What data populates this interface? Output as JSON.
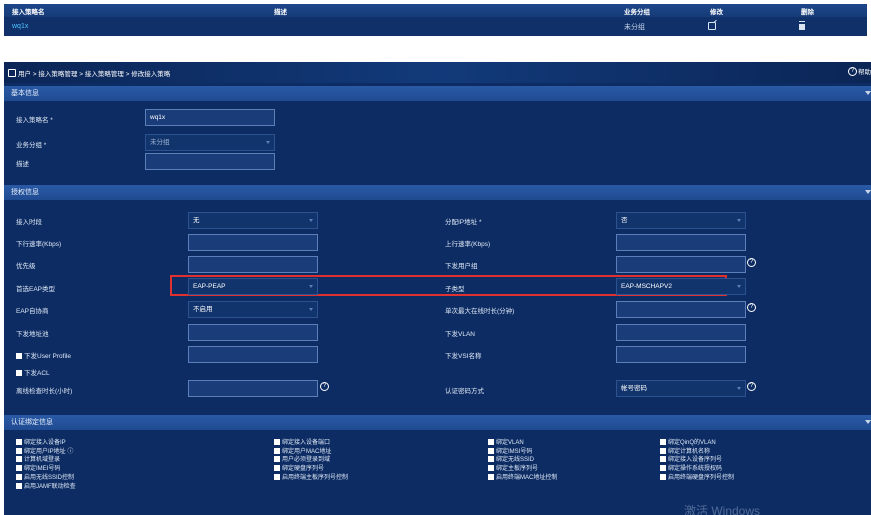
{
  "top_table": {
    "headers": {
      "name": "接入策略名",
      "desc": "描述",
      "group": "业务分组",
      "edit": "修改",
      "delete": "删除"
    },
    "row": {
      "name": "wq1x",
      "desc": "",
      "group": "未分组"
    }
  },
  "breadcrumb": "用户 > 接入策略管理 > 接入策略管理 > 修改接入策略",
  "help_label": "帮助",
  "basic": {
    "title": "基本信息",
    "name_label": "接入策略名 *",
    "name_value": "wq1x",
    "group_label": "业务分组 *",
    "group_value": "未分组",
    "desc_label": "描述",
    "desc_value": ""
  },
  "auth": {
    "title": "授权信息",
    "access_period_label": "接入时段",
    "access_period_value": "无",
    "assign_ip_label": "分配IP地址 *",
    "assign_ip_value": "否",
    "down_rate_label": "下行速率(Kbps)",
    "up_rate_label": "上行速率(Kbps)",
    "priority_label": "优先级",
    "user_group_label": "下发用户组",
    "eap_type_label": "首选EAP类型",
    "eap_type_value": "EAP-PEAP",
    "subtype_label": "子类型",
    "subtype_value": "EAP-MSCHAPV2",
    "eap_negotiate_label": "EAP自协商",
    "eap_negotiate_value": "不启用",
    "max_online_label": "单次最大在线时长(分钟)",
    "addr_pool_label": "下发地址池",
    "vlan_label": "下发VLAN",
    "user_profile_label": "下发User Profile",
    "vsi_label": "下发VSI名称",
    "acl_label": "下发ACL",
    "offline_check_label": "离线检查时长(小时)",
    "auth_pwd_label": "认证密码方式",
    "auth_pwd_value": "帐号密码"
  },
  "binding": {
    "title": "认证绑定信息",
    "col1": [
      "绑定接入设备IP",
      "绑定用户IP地址",
      "计算机域登录",
      "绑定IMEI号码",
      "启用无线SSID控制",
      "启用JAMF联动检查"
    ],
    "col2": [
      "绑定接入设备端口",
      "绑定用户MAC地址",
      "用户必须登录到域",
      "绑定硬盘序列号",
      "启用终端主板序列号控制"
    ],
    "col3": [
      "绑定VLAN",
      "绑定IMSI号码",
      "绑定无线SSID",
      "绑定主板序列号",
      "启用终端MAC地址控制"
    ],
    "col4": [
      "绑定QinQ的VLAN",
      "绑定计算机名称",
      "绑定接入设备序列号",
      "绑定操作系统授权码",
      "启用终端硬盘序列号控制"
    ]
  },
  "watermark": "激活 Windows"
}
